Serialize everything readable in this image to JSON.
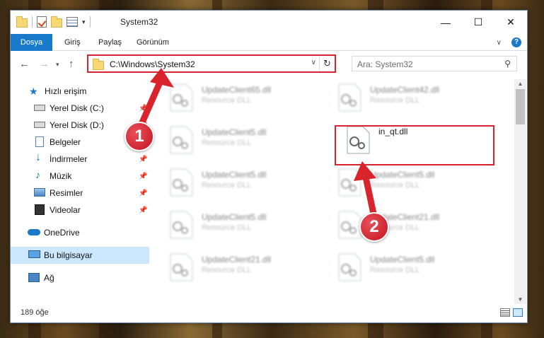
{
  "window": {
    "title": "System32",
    "minimize": "—",
    "maximize": "☐",
    "close": "✕"
  },
  "ribbon": {
    "tabs": [
      "Dosya",
      "Giriş",
      "Paylaş",
      "Görünüm"
    ]
  },
  "navigation": {
    "address": "C:\\Windows\\System32",
    "search_placeholder": "Ara: System32"
  },
  "sidebar": {
    "items": [
      {
        "label": "Hızlı erişim",
        "icon": "star-icon"
      },
      {
        "label": "Yerel Disk (C:)",
        "icon": "drive-icon"
      },
      {
        "label": "Yerel Disk (D:)",
        "icon": "drive-icon"
      },
      {
        "label": "Belgeler",
        "icon": "documents-icon"
      },
      {
        "label": "İndirmeler",
        "icon": "download-icon"
      },
      {
        "label": "Müzik",
        "icon": "music-icon"
      },
      {
        "label": "Resimler",
        "icon": "pictures-icon"
      },
      {
        "label": "Videolar",
        "icon": "videos-icon"
      },
      {
        "label": "OneDrive",
        "icon": "cloud-icon"
      },
      {
        "label": "Bu bilgisayar",
        "icon": "computer-icon"
      },
      {
        "label": "Ağ",
        "icon": "network-icon"
      }
    ]
  },
  "files": [
    {
      "name": "UpdateClient65.dll",
      "type": "Resource DLL"
    },
    {
      "name": "UpdateClient42.dll",
      "type": "Resource DLL"
    },
    {
      "name": "UpdateClient5.dll",
      "type": "Resource DLL"
    },
    {
      "name": "in_qt.dll",
      "type": ""
    },
    {
      "name": "UpdateClient5.dll",
      "type": "Resource DLL"
    },
    {
      "name": "UpdateClient5.dll",
      "type": "Resource DLL"
    },
    {
      "name": "UpdateClient5.dll",
      "type": "Resource DLL"
    },
    {
      "name": "UpdateClient21.dll",
      "type": "Resource DLL"
    },
    {
      "name": "UpdateClient21.dll",
      "type": "Resource DLL"
    },
    {
      "name": "UpdateClient5.dll",
      "type": "Resource DLL"
    }
  ],
  "annotations": {
    "badge1": "1",
    "badge2": "2"
  },
  "status": {
    "item_count": "189 öğe"
  },
  "colors": {
    "accent": "#1979ca",
    "highlight": "#d9232d",
    "selected": "#cce8ff"
  }
}
